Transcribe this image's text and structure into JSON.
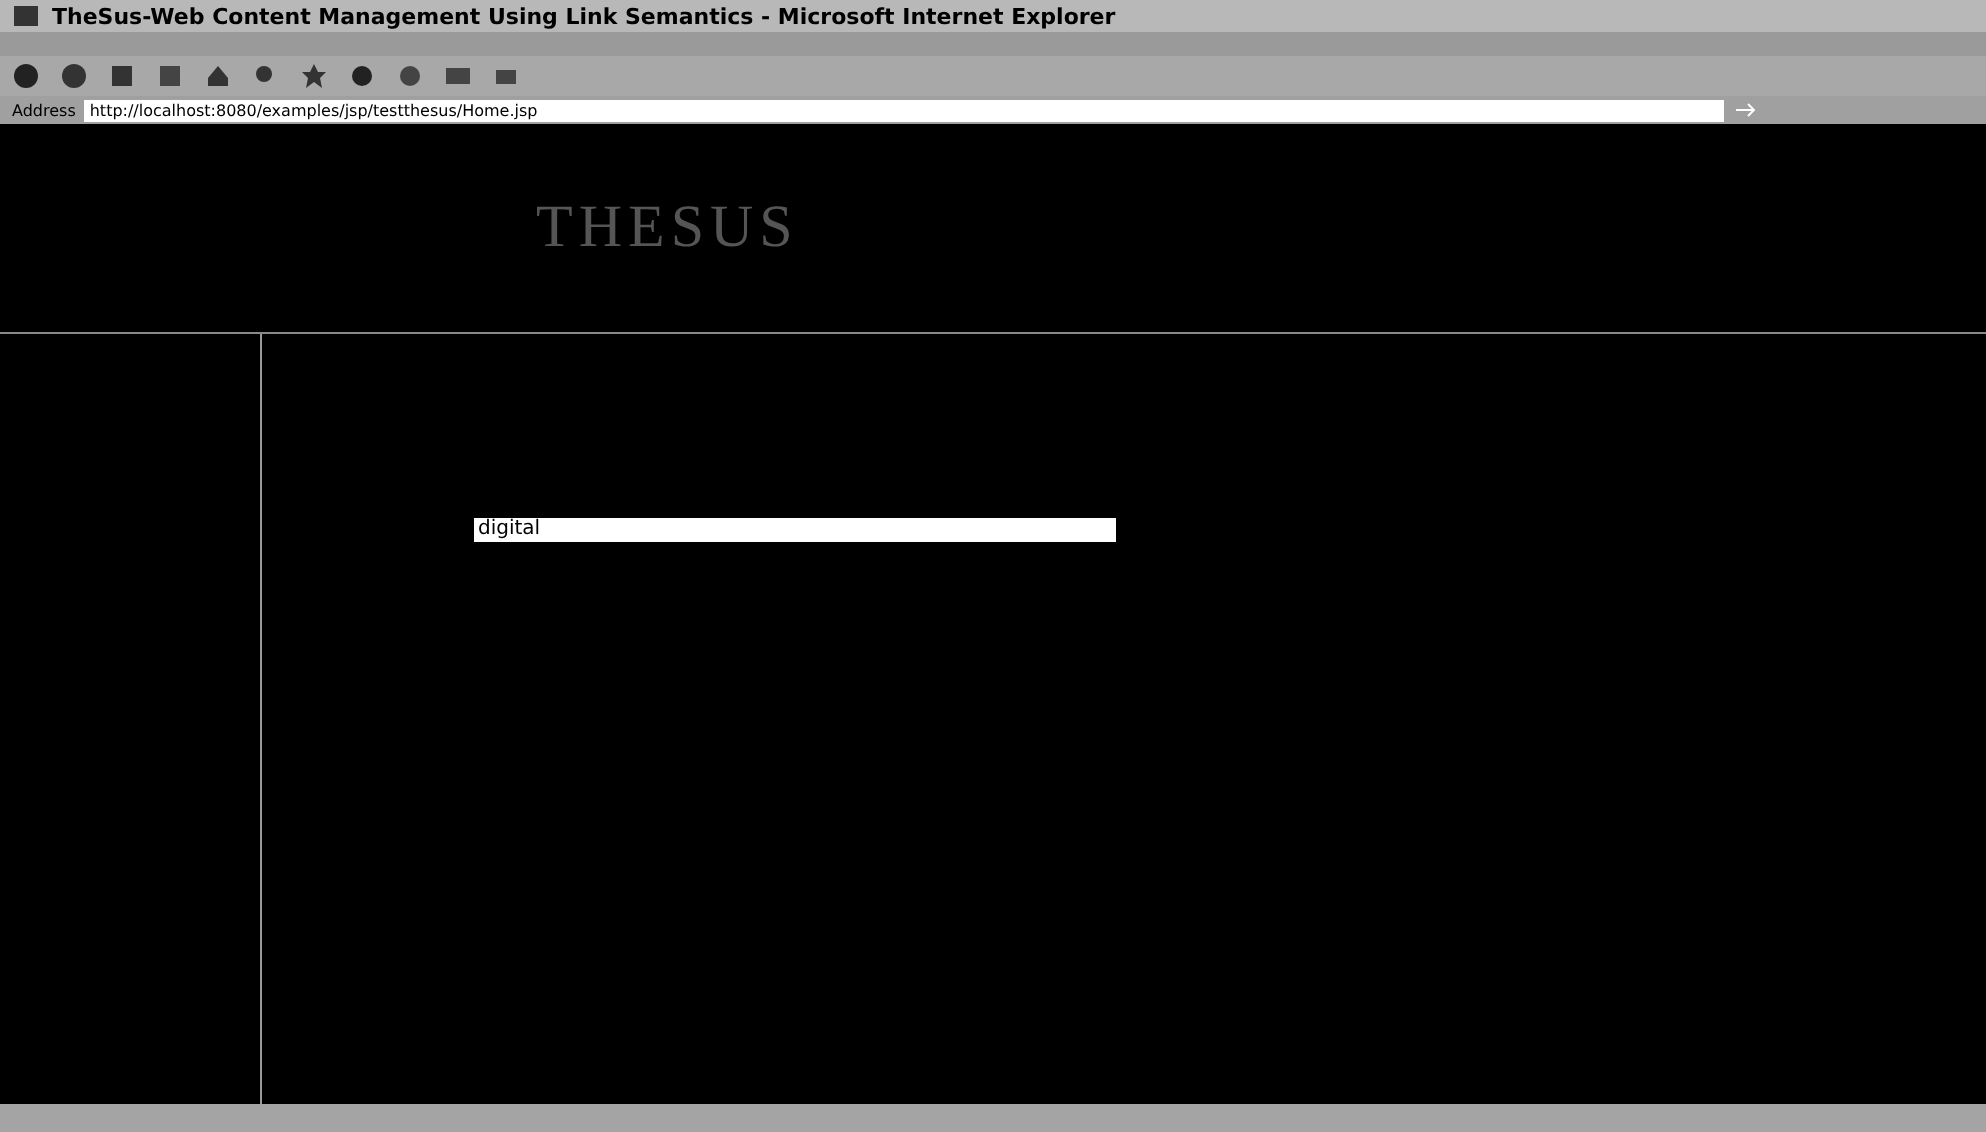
{
  "window": {
    "title": "TheSus-Web Content Management Using Link Semantics - Microsoft Internet Explorer"
  },
  "address_bar": {
    "label": "Address",
    "url": "http://localhost:8080/examples/jsp/testthesus/Home.jsp"
  },
  "page": {
    "logo": "THESUS",
    "search": {
      "value": "digital"
    }
  }
}
